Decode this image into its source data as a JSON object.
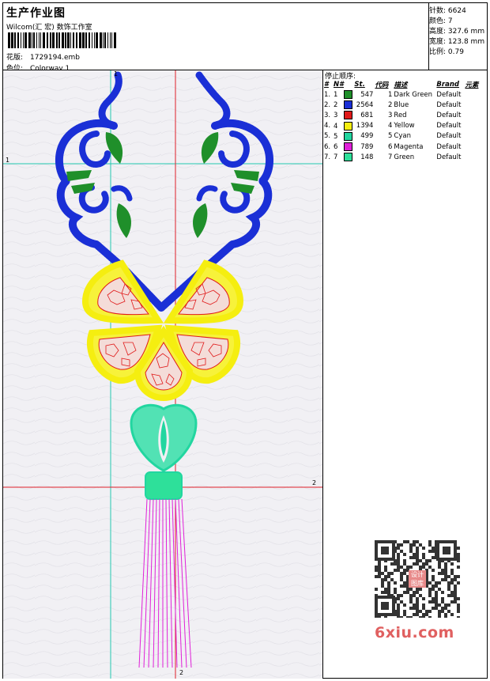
{
  "header": {
    "title": "生产作业图",
    "studio": "Wilcom(汇 宏) 数饰工作室",
    "file_label": "花版:",
    "file_name": "1729194.emb",
    "colorway_label": "色位:",
    "colorway_name": "Colorway 1"
  },
  "stats": [
    {
      "label": "针数:",
      "value": "6624"
    },
    {
      "label": "颜色:",
      "value": "7"
    },
    {
      "label": "高度:",
      "value": "327.6 mm"
    },
    {
      "label": "宽度:",
      "value": "123.8 mm"
    },
    {
      "label": "比例:",
      "value": "0.79"
    }
  ],
  "stops": {
    "title": "停止顺序:",
    "headers": [
      "#",
      "N#",
      "St.",
      "代码",
      "描述",
      "Brand",
      "元素"
    ],
    "rows": [
      {
        "no": "1.",
        "n": "1",
        "color": "#1f8f2a",
        "st": "547",
        "code": "1",
        "desc": "Dark Green",
        "brand": "Default"
      },
      {
        "no": "2.",
        "n": "2",
        "color": "#1a2fd6",
        "st": "2564",
        "code": "2",
        "desc": "Blue",
        "brand": "Default"
      },
      {
        "no": "3.",
        "n": "3",
        "color": "#e01a1a",
        "st": "681",
        "code": "3",
        "desc": "Red",
        "brand": "Default"
      },
      {
        "no": "4.",
        "n": "4",
        "color": "#f5ee10",
        "st": "1394",
        "code": "4",
        "desc": "Yellow",
        "brand": "Default"
      },
      {
        "no": "5.",
        "n": "5",
        "color": "#22d6a0",
        "st": "499",
        "code": "5",
        "desc": "Cyan",
        "brand": "Default"
      },
      {
        "no": "6.",
        "n": "6",
        "color": "#e020d8",
        "st": "789",
        "code": "6",
        "desc": "Magenta",
        "brand": "Default"
      },
      {
        "no": "7.",
        "n": "7",
        "color": "#2ee09a",
        "st": "148",
        "code": "7",
        "desc": "Green",
        "brand": "Default"
      }
    ]
  },
  "axis_marks": {
    "v1": "1",
    "h1": "1",
    "h2": "2",
    "v2": "2"
  },
  "watermark": "6xiu.com",
  "qr_badge": "设计图库"
}
